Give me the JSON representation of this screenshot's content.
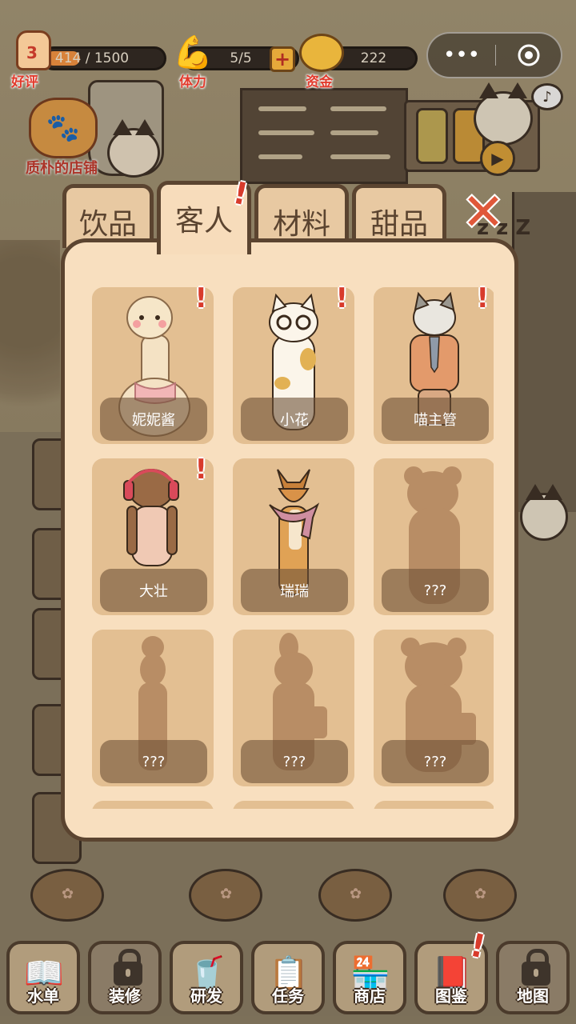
{
  "hud": {
    "reputation": {
      "level": "3",
      "progress_text": "414 / 1500",
      "progress": 0.276,
      "label": "好评"
    },
    "stamina": {
      "value_text": "5/5",
      "label": "体力"
    },
    "funds": {
      "value_text": "222",
      "label": "资金"
    },
    "store_name": "质朴的店铺",
    "capsule": {
      "more_icon": "more-dots-icon",
      "close_icon": "target-circle-icon"
    }
  },
  "collection": {
    "tabs": [
      {
        "label": "饮品",
        "active": false,
        "alert": false
      },
      {
        "label": "客人",
        "active": true,
        "alert": true
      },
      {
        "label": "材料",
        "active": false,
        "alert": false
      },
      {
        "label": "甜品",
        "active": false,
        "alert": false
      }
    ],
    "close_icon": "close-x-icon",
    "customers": [
      {
        "name": "妮妮酱",
        "unlocked": true,
        "alert": true,
        "species": "alpaca"
      },
      {
        "name": "小花",
        "unlocked": true,
        "alert": true,
        "species": "calico-cat"
      },
      {
        "name": "喵主管",
        "unlocked": true,
        "alert": true,
        "species": "grey-cat"
      },
      {
        "name": "大壮",
        "unlocked": true,
        "alert": true,
        "species": "bear"
      },
      {
        "name": "瑞瑞",
        "unlocked": true,
        "alert": false,
        "species": "fox"
      },
      {
        "name": "???",
        "unlocked": false,
        "alert": false,
        "species": "unknown"
      },
      {
        "name": "???",
        "unlocked": false,
        "alert": false,
        "species": "unknown"
      },
      {
        "name": "???",
        "unlocked": false,
        "alert": false,
        "species": "unknown"
      },
      {
        "name": "???",
        "unlocked": false,
        "alert": false,
        "species": "unknown"
      }
    ]
  },
  "bottom_nav": [
    {
      "label": "水单",
      "icon": "menu-book-icon",
      "locked": false,
      "alert": false
    },
    {
      "label": "装修",
      "icon": "lock-icon",
      "locked": true,
      "alert": false
    },
    {
      "label": "研发",
      "icon": "research-cup-icon",
      "locked": false,
      "alert": false
    },
    {
      "label": "任务",
      "icon": "clipboard-icon",
      "locked": false,
      "alert": false
    },
    {
      "label": "商店",
      "icon": "shop-icon",
      "locked": false,
      "alert": false
    },
    {
      "label": "图鉴",
      "icon": "collection-book-icon",
      "locked": false,
      "alert": true
    },
    {
      "label": "地图",
      "icon": "lock-icon",
      "locked": true,
      "alert": false
    }
  ],
  "colors": {
    "panel": "#f8dfbf",
    "card": "#e3bf92",
    "alert": "#d83b2c",
    "border": "#5b4430"
  }
}
